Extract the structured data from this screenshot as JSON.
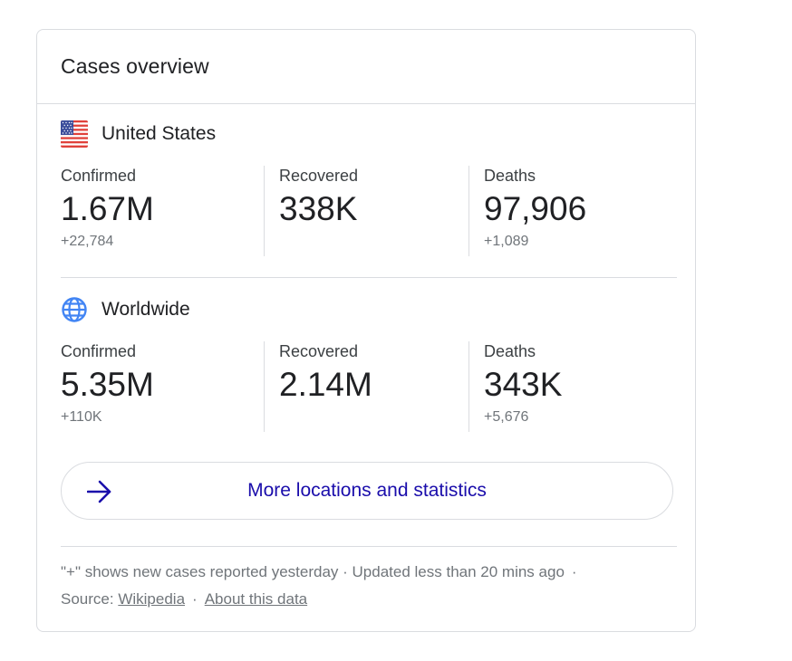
{
  "card": {
    "title": "Cases overview"
  },
  "sections": [
    {
      "location": "United States",
      "icon": "us-flag-icon",
      "confirmed": {
        "label": "Confirmed",
        "value": "1.67M",
        "delta": "+22,784"
      },
      "recovered": {
        "label": "Recovered",
        "value": "338K",
        "delta": ""
      },
      "deaths": {
        "label": "Deaths",
        "value": "97,906",
        "delta": "+1,089"
      }
    },
    {
      "location": "Worldwide",
      "icon": "globe-icon",
      "confirmed": {
        "label": "Confirmed",
        "value": "5.35M",
        "delta": "+110K"
      },
      "recovered": {
        "label": "Recovered",
        "value": "2.14M",
        "delta": ""
      },
      "deaths": {
        "label": "Deaths",
        "value": "343K",
        "delta": "+5,676"
      }
    }
  ],
  "more_button": {
    "label": "More locations and statistics",
    "icon": "arrow-right-icon"
  },
  "footer": {
    "note": "\"+\" shows new cases reported yesterday · Updated less than 20 mins ago",
    "dot": "·",
    "source_label": "Source:",
    "source_link": "Wikipedia",
    "about_link": "About this data"
  },
  "colors": {
    "link": "#1a0dab",
    "text": "#202124",
    "muted": "#70757a",
    "border": "#dadce0",
    "globe": "#4285f4"
  }
}
